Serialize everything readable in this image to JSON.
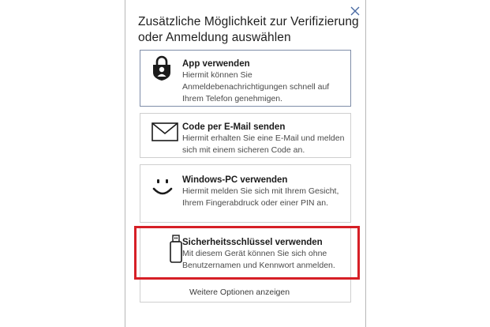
{
  "dialog": {
    "title": "Zusätzliche Möglichkeit zur Verifizierung oder Anmeldung auswählen",
    "close_icon": "close-icon"
  },
  "options": [
    {
      "icon": "lock-person-icon",
      "heading": "App verwenden",
      "description": "Hiermit können Sie Anmeldebenachrichtigungen schnell auf Ihrem Telefon genehmigen."
    },
    {
      "icon": "envelope-icon",
      "heading": "Code per E-Mail senden",
      "description": "Hiermit erhalten Sie eine E-Mail und melden sich mit einem sicheren Code an."
    },
    {
      "icon": "smiley-icon",
      "heading": "Windows-PC verwenden",
      "description": "Hiermit melden Sie sich mit Ihrem Gesicht, Ihrem Fingerabdruck oder einer PIN an."
    },
    {
      "icon": "usb-key-icon",
      "heading": "Sicherheitsschlüssel verwenden",
      "description": "Mit diesem Gerät können Sie sich ohne Benutzernamen und Kennwort anmelden."
    }
  ],
  "more_options": "Weitere Optionen anzeigen",
  "colors": {
    "highlight": "#d61f26",
    "close": "#4a6aa3",
    "border": "#cfcfcf"
  }
}
